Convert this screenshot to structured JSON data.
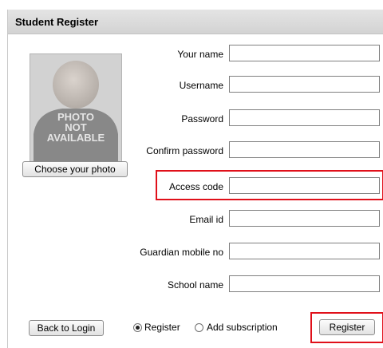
{
  "window": {
    "title": "Student Register"
  },
  "photo": {
    "placeholder_lines": [
      "PHOTO",
      "NOT",
      "AVAILABLE"
    ],
    "choose_label": "Choose your photo"
  },
  "form": {
    "fields": [
      {
        "label": "Your name",
        "value": ""
      },
      {
        "label": "Username",
        "value": ""
      },
      {
        "label": "Password",
        "value": ""
      },
      {
        "label": "Confirm password",
        "value": ""
      },
      {
        "label": "Access code",
        "value": ""
      },
      {
        "label": "Email id",
        "value": ""
      },
      {
        "label": "Guardian mobile no",
        "value": ""
      },
      {
        "label": "School name",
        "value": ""
      }
    ]
  },
  "footer": {
    "back_label": "Back to Login",
    "options": [
      {
        "label": "Register",
        "selected": true
      },
      {
        "label": "Add subscription",
        "selected": false
      }
    ],
    "register_label": "Register"
  },
  "colors": {
    "highlight": "#e0101a",
    "titlebar": "#d8d8d8",
    "photo_bg": "#d2d2d2"
  }
}
